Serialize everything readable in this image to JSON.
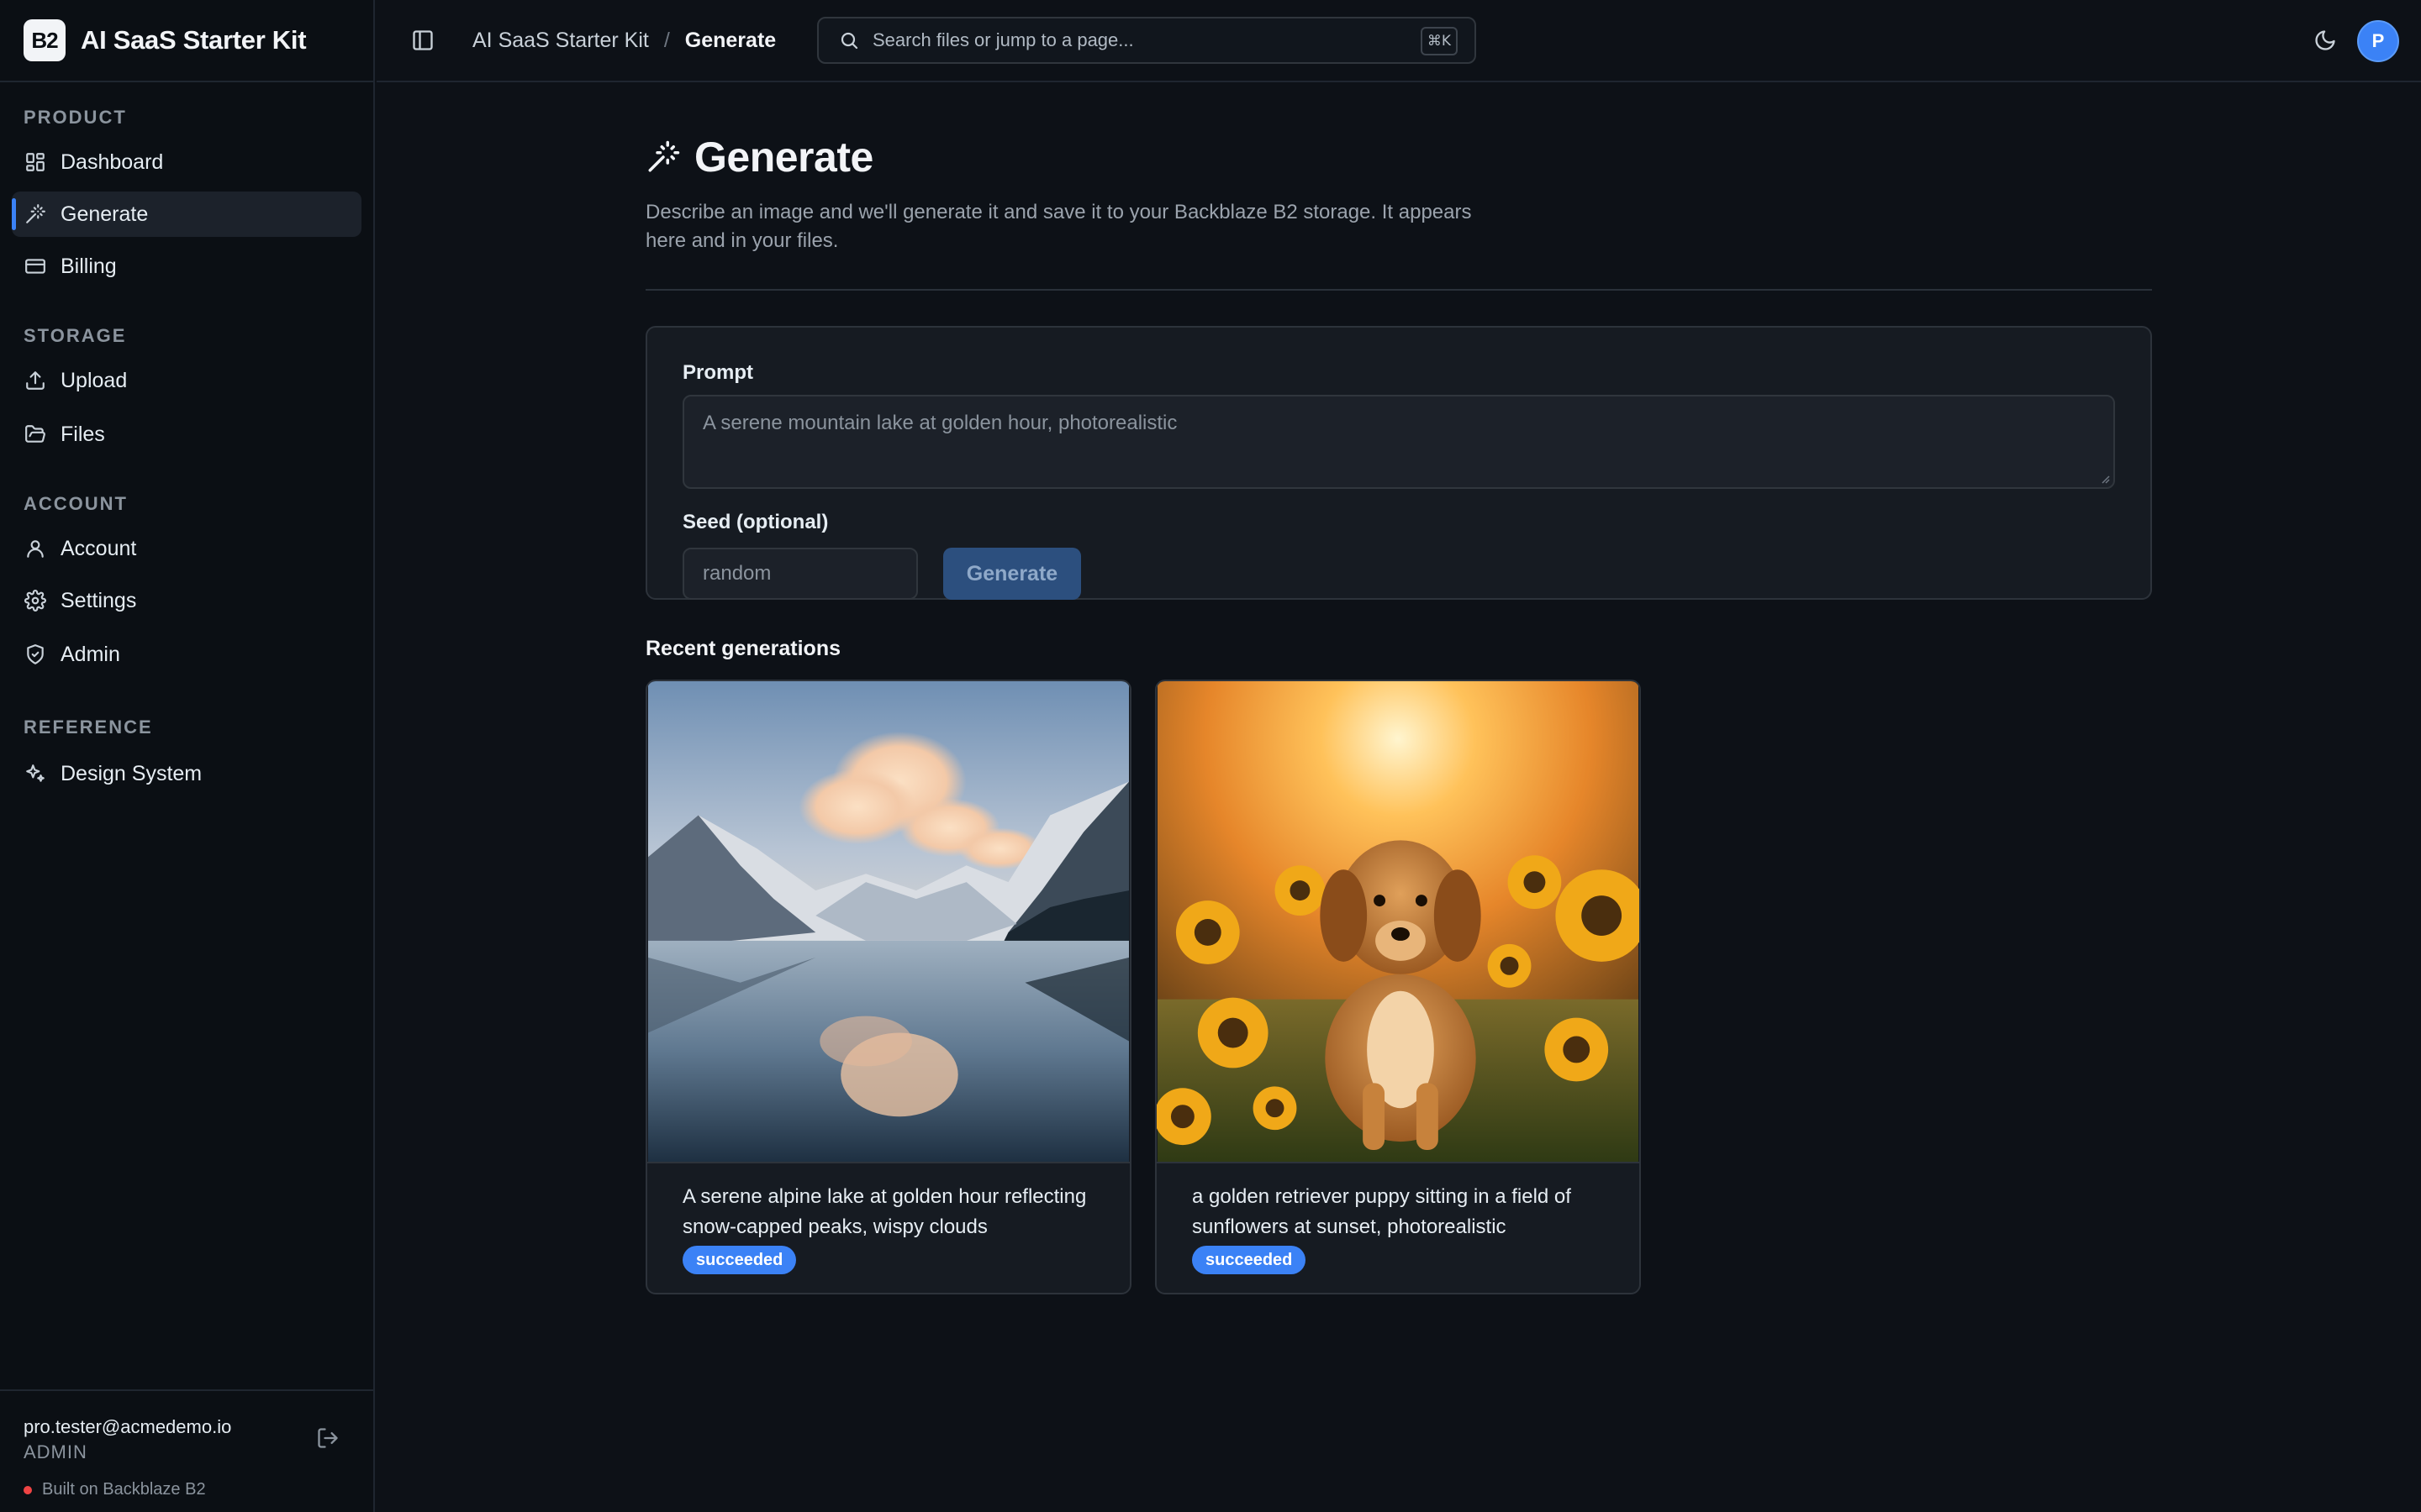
{
  "app": {
    "logo": "B2",
    "name": "AI SaaS Starter Kit"
  },
  "sidebar": {
    "sections": [
      {
        "heading": "PRODUCT",
        "items": [
          {
            "label": "Dashboard",
            "icon": "dashboard-icon"
          },
          {
            "label": "Generate",
            "icon": "wand-icon",
            "active": true
          },
          {
            "label": "Billing",
            "icon": "credit-card-icon"
          }
        ]
      },
      {
        "heading": "STORAGE",
        "items": [
          {
            "label": "Upload",
            "icon": "upload-icon"
          },
          {
            "label": "Files",
            "icon": "folder-icon"
          }
        ]
      },
      {
        "heading": "ACCOUNT",
        "items": [
          {
            "label": "Account",
            "icon": "user-icon"
          },
          {
            "label": "Settings",
            "icon": "gear-icon"
          },
          {
            "label": "Admin",
            "icon": "shield-icon"
          }
        ]
      },
      {
        "heading": "REFERENCE",
        "items": [
          {
            "label": "Design System",
            "icon": "sparkles-icon"
          }
        ]
      }
    ],
    "user": {
      "email": "pro.tester@acmedemo.io",
      "role": "ADMIN"
    },
    "built_on": "Built on Backblaze B2"
  },
  "topbar": {
    "breadcrumb": {
      "root": "AI SaaS Starter Kit",
      "separator": "/",
      "current": "Generate"
    },
    "search": {
      "placeholder": "Search files or jump to a page...",
      "shortcut": "⌘K"
    },
    "avatar_initial": "P"
  },
  "page": {
    "title": "Generate",
    "description": "Describe an image and we'll generate it and save it to your Backblaze B2 storage. It appears here and in your files."
  },
  "form": {
    "prompt_label": "Prompt",
    "prompt_placeholder": "A serene mountain lake at golden hour, photorealistic",
    "seed_label": "Seed (optional)",
    "seed_placeholder": "random",
    "generate_button": "Generate"
  },
  "recent": {
    "title": "Recent generations",
    "items": [
      {
        "caption": "A serene alpine lake at golden hour reflecting snow-capped peaks, wispy clouds",
        "status": "succeeded",
        "image": "mountain-lake-image"
      },
      {
        "caption": "a golden retriever puppy sitting in a field of sunflowers at sunset, photorealistic",
        "status": "succeeded",
        "image": "puppy-sunflowers-image"
      }
    ]
  },
  "colors": {
    "accent": "#3b82f6",
    "background": "#0d1117",
    "sidebar": "#0b0f14",
    "card": "#161b22",
    "status_dot": "#ef4444"
  }
}
